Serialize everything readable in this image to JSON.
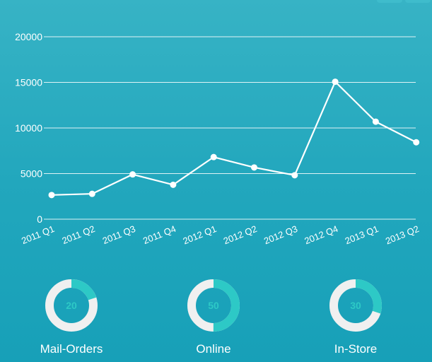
{
  "chart_data": {
    "type": "line",
    "categories": [
      "2011 Q1",
      "2011 Q2",
      "2011 Q3",
      "2011 Q4",
      "2012 Q1",
      "2012 Q2",
      "2012 Q3",
      "2012 Q4",
      "2013 Q1",
      "2013 Q2"
    ],
    "series": [
      {
        "values": [
          2650,
          2780,
          4910,
          3770,
          6810,
          5670,
          4820,
          15070,
          10690,
          8430
        ]
      }
    ],
    "ylim": [
      0,
      20000
    ],
    "yticks": [
      "0",
      "5000",
      "10000",
      "15000",
      "20000"
    ],
    "grid": true,
    "colors": {
      "line": "#ffffff",
      "grid": "#ffffff"
    }
  },
  "donuts": [
    {
      "label": "Mail-Orders",
      "value": "20",
      "percent": 20
    },
    {
      "label": "Online",
      "value": "50",
      "percent": 50
    },
    {
      "label": "In-Store",
      "value": "30",
      "percent": 30
    }
  ],
  "colors": {
    "donut_fill": "#2dc9c6",
    "donut_track": "#f0f0f0",
    "donut_text": "#2dc9c6"
  }
}
